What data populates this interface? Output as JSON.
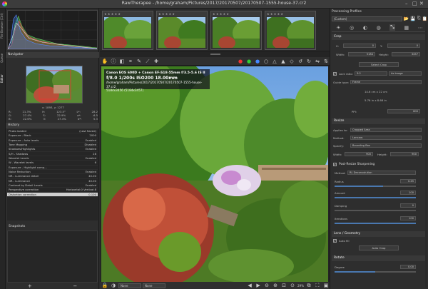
{
  "window": {
    "title": "RawTherapee - /home/graham/Pictures/2017/20170507/20170507-1555-house-37.cr2",
    "controls": [
      "–",
      "□",
      "✕"
    ]
  },
  "vtabs": [
    "File Browser (Ctrl)",
    "Queue",
    "Editor"
  ],
  "left": {
    "navigator_title": "Navigator",
    "nav_info": {
      "rgb": [
        "R:",
        "G:",
        "B:"
      ],
      "rgb_vals": [
        "21.3%",
        "27.4%",
        "22.6%"
      ],
      "hsv_labels": [
        "H:",
        "S:",
        "V:"
      ],
      "hsv_vals": [
        "123.5°",
        "22.9%",
        "27.4%"
      ],
      "lab_labels": [
        "L*:",
        "a*:",
        "b*:"
      ],
      "lab_vals": [
        "28.2",
        "-6.5",
        "5.3"
      ],
      "pos": "x: 1893, y: 1277"
    },
    "history_title": "History",
    "history": [
      {
        "name": "Photo loaded",
        "value": "(Last Saved)"
      },
      {
        "name": "Exposure - Black",
        "value": "2000"
      },
      {
        "name": "Exposure - Auto levels",
        "value": "Enabled"
      },
      {
        "name": "Tone Mapping",
        "value": "Disabled"
      },
      {
        "name": "Shadows/Highlights",
        "value": "Enabled"
      },
      {
        "name": "S/H - Shadows",
        "value": "28"
      },
      {
        "name": "Wavelet Levels",
        "value": "Enabled"
      },
      {
        "name": "W - Wavelet levels",
        "value": "6"
      },
      {
        "name": "Exposure - Highlight comp...",
        "value": ""
      },
      {
        "name": "Noise Reduction",
        "value": "Enabled"
      },
      {
        "name": "NR - Luminance detail",
        "value": "40.00"
      },
      {
        "name": "NR - Luminance",
        "value": "40.00"
      },
      {
        "name": "Contrast by Detail Levels",
        "value": "Enabled"
      },
      {
        "name": "Perspective correction",
        "value": "Horizontal:0 Vertical:8"
      },
      {
        "name": "Distortion correction",
        "value": "0.100"
      }
    ],
    "snapshots_title": "Snapshots",
    "snap_add": "+",
    "snap_remove": "−"
  },
  "filmstrip": {
    "thumbs": [
      {
        "stars": "★ ★ ★ ★ ★"
      },
      {
        "stars": "★ ★ ★ ★ ★"
      },
      {
        "stars": "★ ★ ★ ★ ★"
      },
      {
        "stars": "★ ★ ★ ★ ★"
      }
    ]
  },
  "overlay": {
    "camera": "Canon EOS 600D + Canon EF-S18-55mm f/3.5-5.6 IS II",
    "exposure": "f/8.0  1/200s  ISO200  18.00mm",
    "path": "/home/graham/Pictures/2017/20170507/20170507-1555-house-37.cr2",
    "dims": "5184x3456 (5184x3457)"
  },
  "bottombar": {
    "profile": "None",
    "intent": "None",
    "zoom": "29%"
  },
  "right": {
    "processing_profiles": "Processing Profiles",
    "profile_value": "(Custom)",
    "crop": {
      "title": "Crop",
      "x_label": "X:",
      "x_val": "0",
      "y_label": "Y:",
      "y_val": "0",
      "w_label": "Width:",
      "w_val": "5184",
      "h_label": "Height:",
      "h_val": "3457",
      "select_btn": "Select Crop",
      "lock_label": "Lock ratio:",
      "lock_val": "3:2",
      "orient": "As Image",
      "guide_label": "Guide type:",
      "guide_val": "Frame",
      "size1": "14.6 cm x 22 cm",
      "size2": "5.76 in x 8.66 in",
      "ppi_label": "PPI:",
      "ppi_val": "600"
    },
    "resize": {
      "title": "Resize",
      "applies_label": "Applies to:",
      "applies_val": "Cropped Area",
      "method_label": "Method:",
      "method_val": "Lanczos",
      "specify_label": "Specify:",
      "specify_val": "Bounding Box",
      "width_label": "Width:",
      "width_val": "900",
      "height_label": "Height:",
      "height_val": "900"
    },
    "pr_sharpen": {
      "title": "Post-Resize Sharpening",
      "method_label": "Method:",
      "method_val": "RL Deconvolution",
      "radius_label": "Radius",
      "radius_val": "0.45",
      "radius_frac": 0.6,
      "amount_label": "Amount",
      "amount_val": "100",
      "amount_frac": 1.0,
      "damping_label": "Damping",
      "damping_val": "0",
      "damping_frac": 0.0,
      "iter_label": "Iterations",
      "iter_val": "100",
      "iter_frac": 1.0
    },
    "lens": {
      "title": "Lens / Geometry",
      "autofill": "Auto fill",
      "autocrop": "Auto Crop"
    },
    "rotate": {
      "title": "Rotate",
      "degree_label": "Degree",
      "degree_val": "0.00",
      "degree_frac": 0.5
    }
  }
}
